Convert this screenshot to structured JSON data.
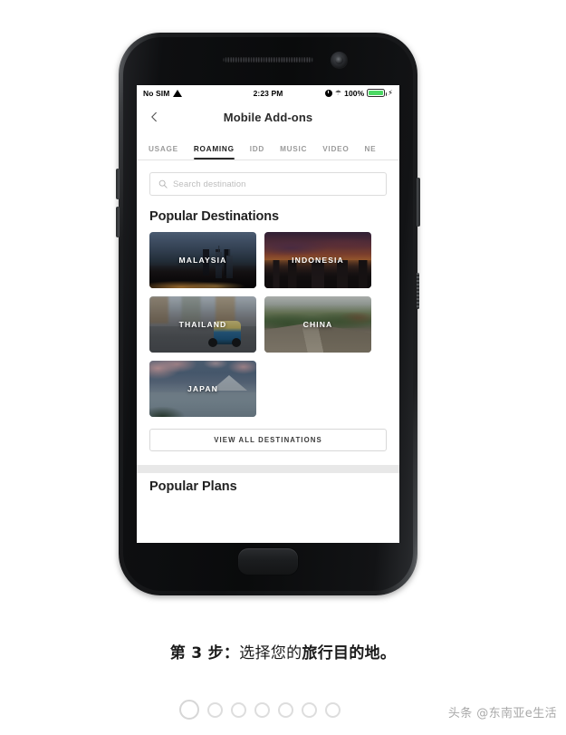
{
  "phone": {
    "status_bar": {
      "carrier": "No SIM",
      "wifi_icon": "wifi-icon",
      "time": "2:23 PM",
      "alarm_icon": "alarm-clock-icon",
      "bluetooth_icon": "bluetooth-icon",
      "battery_percent": "100%",
      "charging_icon": "charging-bolt-icon",
      "battery_level": 100,
      "battery_color": "#4cd964"
    },
    "nav": {
      "back_icon": "back-chevron-icon",
      "title": "Mobile Add-ons"
    },
    "tabs": [
      {
        "label": "USAGE",
        "active": false
      },
      {
        "label": "ROAMING",
        "active": true
      },
      {
        "label": "IDD",
        "active": false
      },
      {
        "label": "MUSIC",
        "active": false
      },
      {
        "label": "VIDEO",
        "active": false
      },
      {
        "label": "NE",
        "active": false
      }
    ],
    "search": {
      "icon": "search-icon",
      "placeholder": "Search destination",
      "value": ""
    },
    "section": {
      "title": "Popular Destinations"
    },
    "destinations": [
      {
        "label": "MALAYSIA",
        "art": "malaysia"
      },
      {
        "label": "INDONESIA",
        "art": "indonesia"
      },
      {
        "label": "THAILAND",
        "art": "thailand"
      },
      {
        "label": "CHINA",
        "art": "china"
      },
      {
        "label": "JAPAN",
        "art": "japan"
      }
    ],
    "view_all_label": "VIEW ALL DESTINATIONS",
    "next_section_title": "Popular Plans"
  },
  "caption": {
    "step_prefix": "第 3 步：",
    "middle": "选择您的",
    "emphasis": "旅行目的地。"
  },
  "footer": {
    "dots_count": 7,
    "watermark": "头条 @东南亚e生活"
  },
  "colors": {
    "accent": "#2b2b2b",
    "battery_green": "#4cd964",
    "muted_text": "#9b9b9b",
    "placeholder": "#bdbdbd"
  }
}
